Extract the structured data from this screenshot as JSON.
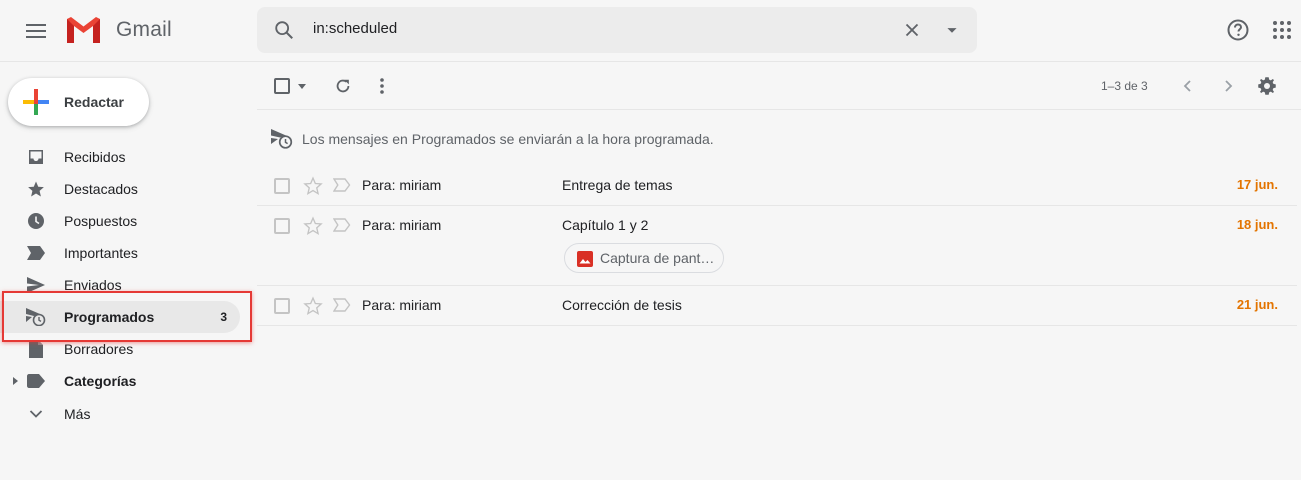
{
  "app": {
    "name": "Gmail"
  },
  "search": {
    "query": "in:scheduled"
  },
  "compose": {
    "label": "Redactar"
  },
  "sidebar": {
    "items": [
      {
        "label": "Recibidos",
        "icon": "inbox-icon"
      },
      {
        "label": "Destacados",
        "icon": "star-icon"
      },
      {
        "label": "Pospuestos",
        "icon": "clock-icon"
      },
      {
        "label": "Importantes",
        "icon": "important-icon"
      },
      {
        "label": "Enviados",
        "icon": "send-icon"
      },
      {
        "label": "Programados",
        "icon": "scheduled-icon",
        "count": "3",
        "active": true
      },
      {
        "label": "Borradores",
        "icon": "draft-icon"
      },
      {
        "label": "Categorías",
        "icon": "label-icon"
      },
      {
        "label": "Más",
        "icon": "chevron-down-icon"
      }
    ]
  },
  "toolbar": {
    "page_info": "1–3 de 3"
  },
  "banner": {
    "text": "Los mensajes en Programados se enviarán a la hora programada."
  },
  "messages": [
    {
      "to": "Para: miriam",
      "subject": "Entrega de temas",
      "date": "17 jun."
    },
    {
      "to": "Para: miriam",
      "subject": "Capítulo 1 y 2",
      "date": "18 jun.",
      "attachment": "Captura de pant…"
    },
    {
      "to": "Para: miriam",
      "subject": "Corrección de tesis",
      "date": "21 jun."
    }
  ],
  "colors": {
    "accent_date": "#e37400",
    "highlight_box": "#e53935",
    "active_nav_bg": "#e8e8e8"
  }
}
